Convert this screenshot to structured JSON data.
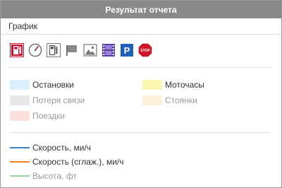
{
  "window": {
    "title": "Результат отчета"
  },
  "section": {
    "title": "График"
  },
  "toolbar": {
    "tools": [
      {
        "icon": "fuel-pump-icon"
      },
      {
        "icon": "speedometer-icon"
      },
      {
        "icon": "fuel-station-icon"
      },
      {
        "icon": "flag-icon"
      },
      {
        "icon": "image-icon"
      },
      {
        "icon": "video-icon"
      },
      {
        "icon": "parking-icon",
        "text": "P"
      },
      {
        "icon": "stop-sign-icon",
        "text": "STOP"
      }
    ]
  },
  "legend": {
    "stops": {
      "label": "Остановки",
      "color": "#dcefff"
    },
    "engine_hours": {
      "label": "Моточасы",
      "color": "#fbf4b3"
    },
    "connection_loss": {
      "label": "Потеря связи",
      "color": "#e8e8e8"
    },
    "parkings": {
      "label": "Стоянки",
      "color": "#fdf0d8"
    },
    "trips": {
      "label": "Поездки",
      "color": "#fde0dc"
    }
  },
  "series": {
    "speed": {
      "label": "Скорость, ми/ч",
      "color": "#3b7fc4"
    },
    "speed_smoothed": {
      "label": "Скорость (сглаж.), ми/ч",
      "color": "#f07d1f"
    },
    "altitude": {
      "label": "Высота, фт",
      "color": "#9ad09a"
    }
  }
}
